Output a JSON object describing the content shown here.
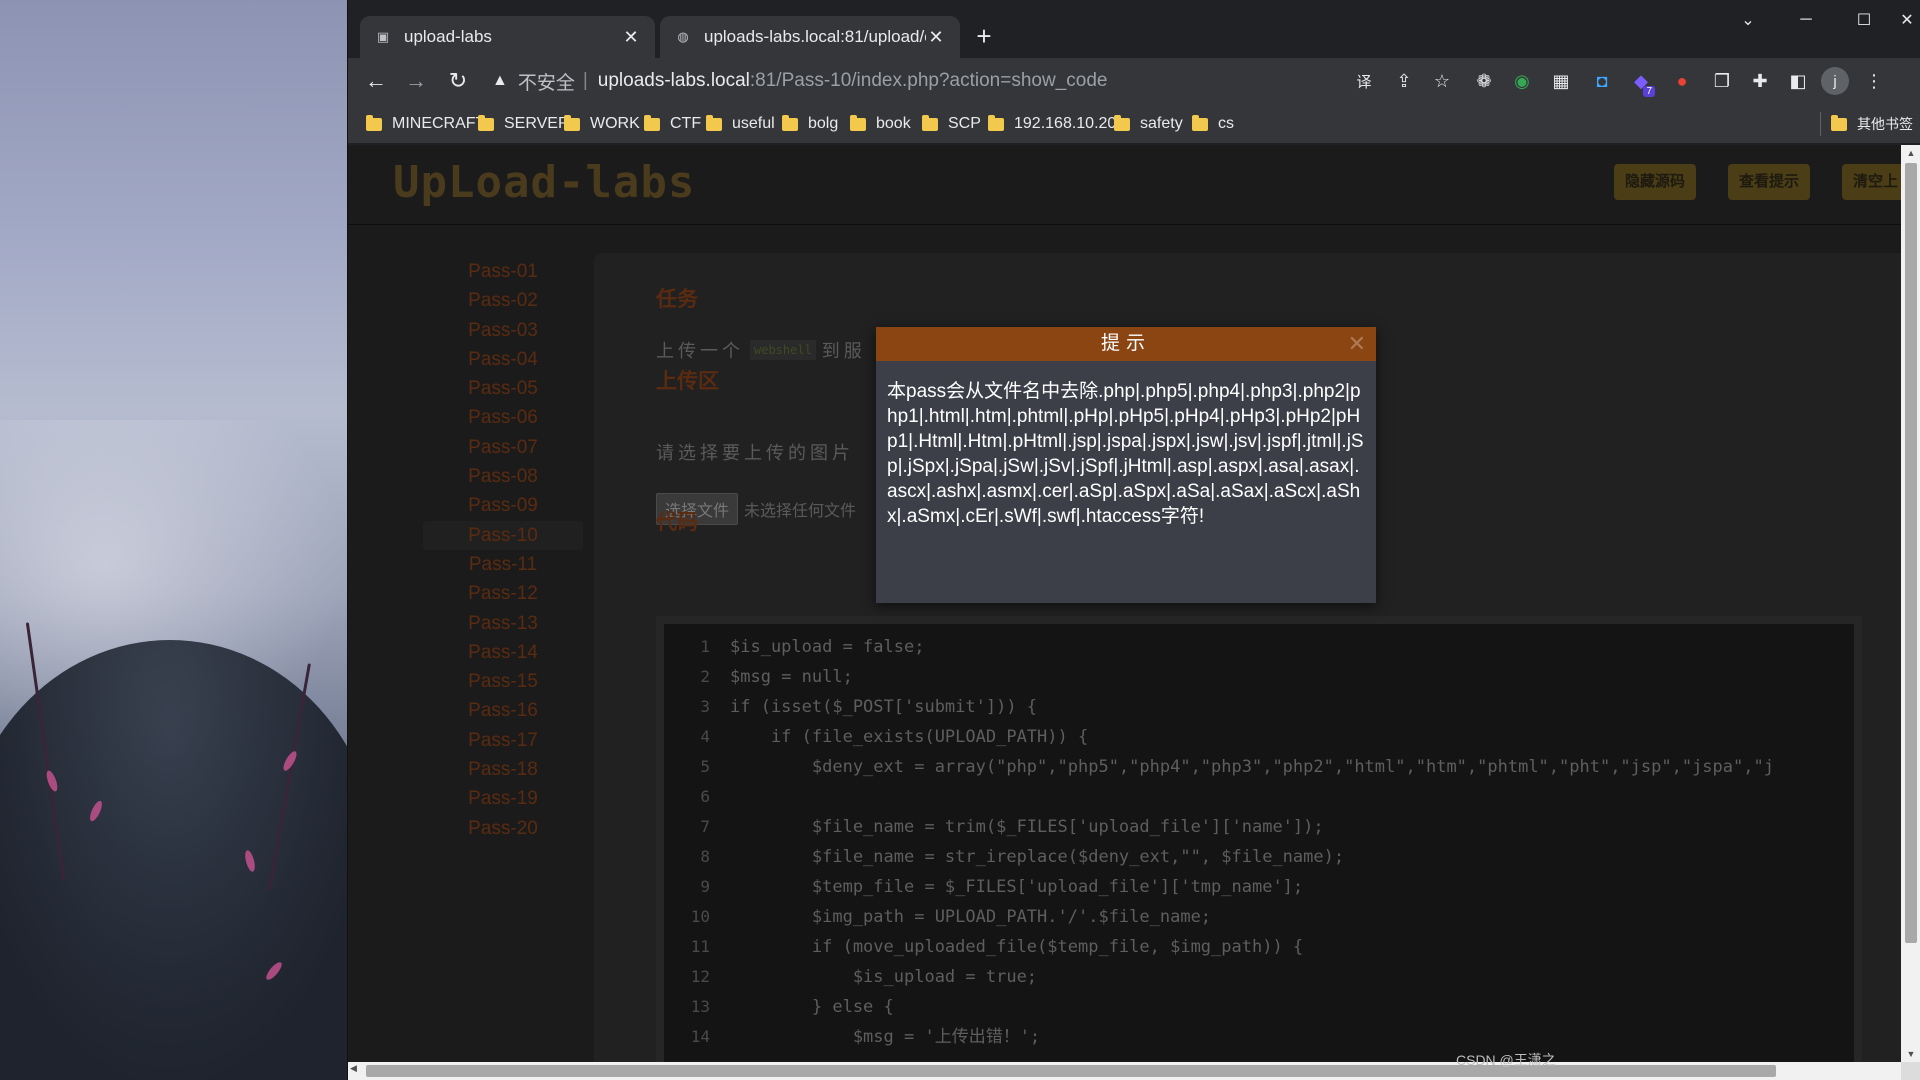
{
  "browser": {
    "tabs": [
      {
        "title": "upload-labs",
        "active": false
      },
      {
        "title": "uploads-labs.local:81/upload/c",
        "active": true
      }
    ],
    "address": {
      "warning": "不安全",
      "host": "uploads-labs.local",
      "rest": ":81/Pass-10/index.php?action=show_code"
    },
    "bookmarks": [
      "MINECRAFT",
      "SERVER",
      "WORK",
      "CTF",
      "useful",
      "bolg",
      "book",
      "SCP",
      "192.168.10.20",
      "safety",
      "cs"
    ],
    "other_bookmarks": "其他书签",
    "profile_initial": "j",
    "extension_badge": "7"
  },
  "page": {
    "logo": "UpLoad-labs",
    "header_buttons": [
      "隐藏源码",
      "查看提示",
      "清空上"
    ],
    "passes": [
      "Pass-01",
      "Pass-02",
      "Pass-03",
      "Pass-04",
      "Pass-05",
      "Pass-06",
      "Pass-07",
      "Pass-08",
      "Pass-09",
      "Pass-10",
      "Pass-11",
      "Pass-12",
      "Pass-13",
      "Pass-14",
      "Pass-15",
      "Pass-16",
      "Pass-17",
      "Pass-18",
      "Pass-19",
      "Pass-20"
    ],
    "current_pass": "Pass-10",
    "task": {
      "title": "任务",
      "text_before": "上传一个",
      "code": "webshell",
      "text_after": "到服"
    },
    "upload": {
      "title": "上传区",
      "prompt": "请选择要上传的图片",
      "choose_button": "选择文件",
      "no_file": "未选择任何文件"
    },
    "code": {
      "title": "代码",
      "lines": [
        {
          "n": "1",
          "text": "$is_upload = false;"
        },
        {
          "n": "2",
          "text": "$msg = null;"
        },
        {
          "n": "3",
          "text": "if (isset($_POST['submit'])) {"
        },
        {
          "n": "4",
          "text": "    if (file_exists(UPLOAD_PATH)) {"
        },
        {
          "n": "5",
          "text": "        $deny_ext = array(\"php\",\"php5\",\"php4\",\"php3\",\"php2\",\"html\",\"htm\",\"phtml\",\"pht\",\"jsp\",\"jspa\",\"j"
        },
        {
          "n": "6",
          "text": ""
        },
        {
          "n": "7",
          "text": "        $file_name = trim($_FILES['upload_file']['name']);"
        },
        {
          "n": "8",
          "text": "        $file_name = str_ireplace($deny_ext,\"\", $file_name);"
        },
        {
          "n": "9",
          "text": "        $temp_file = $_FILES['upload_file']['tmp_name'];"
        },
        {
          "n": "10",
          "text": "        $img_path = UPLOAD_PATH.'/'.$file_name;"
        },
        {
          "n": "11",
          "text": "        if (move_uploaded_file($temp_file, $img_path)) {"
        },
        {
          "n": "12",
          "text": "            $is_upload = true;"
        },
        {
          "n": "13",
          "text": "        } else {"
        },
        {
          "n": "14",
          "text": "            $msg = '上传出错！';"
        }
      ]
    }
  },
  "modal": {
    "title": "提示",
    "close": "✕",
    "message": "本pass会从文件名中去除.php|.php5|.php4|.php3|.php2|php1|.html|.htm|.phtml|.pHp|.pHp5|.pHp4|.pHp3|.pHp2|pHp1|.Html|.Htm|.pHtml|.jsp|.jspa|.jspx|.jsw|.jsv|.jspf|.jtml|.jSp|.jSpx|.jSpa|.jSw|.jSv|.jSpf|.jHtml|.asp|.aspx|.asa|.asax|.ascx|.ashx|.asmx|.cer|.aSp|.aSpx|.aSa|.aSax|.aScx|.aShx|.aSmx|.cEr|.sWf|.swf|.htaccess字符!"
  },
  "watermark": "CSDN @王潇之",
  "colors": {
    "accent_brown": "#8b4513",
    "pass_link": "#5a2b10",
    "folder": "#f2c94c"
  }
}
